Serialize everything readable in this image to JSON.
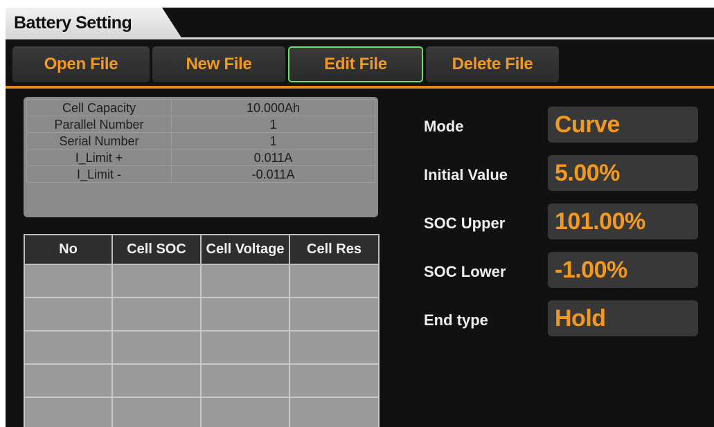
{
  "title": "Battery Setting",
  "toolbar": {
    "open_label": "Open File",
    "new_label": "New File",
    "edit_label": "Edit File",
    "delete_label": "Delete File",
    "active": "Edit File"
  },
  "params": [
    {
      "label": "Cell Capacity",
      "value": "10.000Ah"
    },
    {
      "label": "Parallel Number",
      "value": "1"
    },
    {
      "label": "Serial Number",
      "value": "1"
    },
    {
      "label": "I_Limit +",
      "value": "0.011A"
    },
    {
      "label": "I_Limit -",
      "value": "-0.011A"
    }
  ],
  "cell_table": {
    "headers": [
      "No",
      "Cell SOC",
      "Cell Voltage",
      "Cell Res"
    ],
    "rows": [
      [
        "",
        "",
        "",
        ""
      ],
      [
        "",
        "",
        "",
        ""
      ],
      [
        "",
        "",
        "",
        ""
      ],
      [
        "",
        "",
        "",
        ""
      ],
      [
        "",
        "",
        "",
        ""
      ]
    ]
  },
  "fields": {
    "mode": {
      "label": "Mode",
      "value": "Curve"
    },
    "initial_value": {
      "label": "Initial Value",
      "value": "5.00%"
    },
    "soc_upper": {
      "label": "SOC Upper",
      "value": "101.00%"
    },
    "soc_lower": {
      "label": "SOC Lower",
      "value": "-1.00%"
    },
    "end_type": {
      "label": "End type",
      "value": "Hold"
    }
  },
  "colors": {
    "accent": "#f39a1e",
    "active_border": "#66e066",
    "background": "#111111"
  }
}
